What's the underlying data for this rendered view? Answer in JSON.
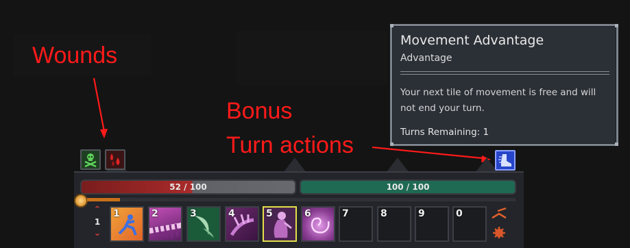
{
  "annotations": {
    "wounds": "Wounds",
    "bonus": "Bonus",
    "turn_actions": "Turn actions",
    "color": "#ff1a1a"
  },
  "tooltip": {
    "title": "Movement Advantage",
    "subtitle": "Advantage",
    "description": "Your next tile of movement is free and will not end your turn.",
    "turns_remaining": "Turns Remaining: 1"
  },
  "status_icons": {
    "wound_icons": [
      "skull-crossbones-icon",
      "blood-drops-icon"
    ],
    "bonus_icon": "boot-icon"
  },
  "hud": {
    "health_text": "52 / 100",
    "health_fraction": 0.52,
    "mana_text": "100 / 100",
    "mana_fraction": 1.0,
    "turn_number": "1",
    "ability_slots": [
      {
        "key": "1",
        "icon": "blue-runner-icon"
      },
      {
        "key": "2",
        "icon": "purple-spikes-icon"
      },
      {
        "key": "3",
        "icon": "green-crescent-icon"
      },
      {
        "key": "4",
        "icon": "purple-claw-icon"
      },
      {
        "key": "5",
        "icon": "purple-figure-icon",
        "selected": true
      },
      {
        "key": "6",
        "icon": "purple-vortex-icon"
      },
      {
        "key": "7",
        "icon": ""
      },
      {
        "key": "8",
        "icon": ""
      },
      {
        "key": "9",
        "icon": ""
      },
      {
        "key": "0",
        "icon": ""
      }
    ],
    "colors": {
      "health": "#a92a2a",
      "mana": "#1f6a53",
      "selected_slot": "#e6e04a"
    }
  }
}
